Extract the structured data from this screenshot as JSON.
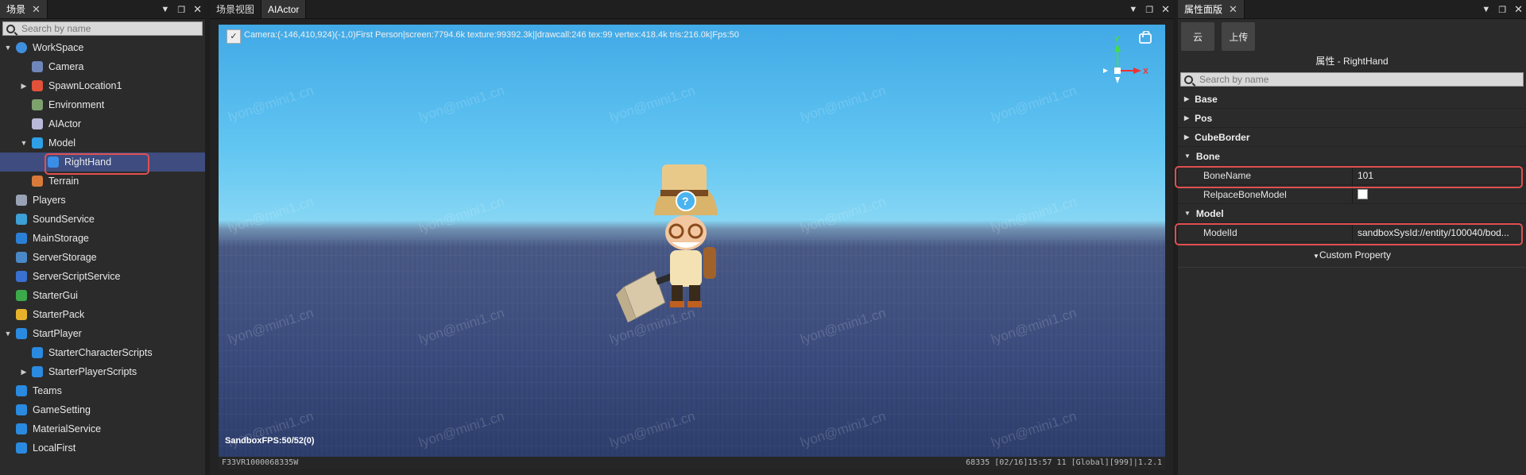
{
  "scene_panel": {
    "tab_label": "场景",
    "search_placeholder": "Search by name",
    "items": [
      {
        "label": "WorkSpace",
        "icon": "globe-icon",
        "color": "#3f8fe0",
        "expanded": "open"
      },
      {
        "label": "Camera",
        "icon": "camera-icon",
        "color": "#6f86b8"
      },
      {
        "label": "SpawnLocation1",
        "icon": "spawn-icon",
        "color": "#e2523a",
        "expanded": "closed"
      },
      {
        "label": "Environment",
        "icon": "environment-icon",
        "color": "#7ea26e"
      },
      {
        "label": "AIActor",
        "icon": "actor-icon",
        "color": "#b9b9d9"
      },
      {
        "label": "Model",
        "icon": "cube-icon",
        "color": "#2ea0e8",
        "expanded": "open"
      },
      {
        "label": "RightHand",
        "icon": "bone-icon",
        "color": "#3a8ee8"
      },
      {
        "label": "Terrain",
        "icon": "terrain-icon",
        "color": "#d97a3a"
      },
      {
        "label": "Players",
        "icon": "players-icon",
        "color": "#9aa2b6"
      },
      {
        "label": "SoundService",
        "icon": "sound-icon",
        "color": "#3da0d6"
      },
      {
        "label": "MainStorage",
        "icon": "storage-icon",
        "color": "#2c7fd6"
      },
      {
        "label": "ServerStorage",
        "icon": "storage-icon",
        "color": "#4a88c8"
      },
      {
        "label": "ServerScriptService",
        "icon": "script-service-icon",
        "color": "#3a70d0"
      },
      {
        "label": "StarterGui",
        "icon": "gui-icon",
        "color": "#3caa4a"
      },
      {
        "label": "StarterPack",
        "icon": "pack-icon",
        "color": "#e6b22c"
      },
      {
        "label": "StartPlayer",
        "icon": "player-icon",
        "color": "#2a8ae0",
        "expanded": "open"
      },
      {
        "label": "StarterCharacterScripts",
        "icon": "script-icon",
        "color": "#2a8ae0"
      },
      {
        "label": "StarterPlayerScripts",
        "icon": "script-icon",
        "color": "#2a8ae0",
        "expanded": "closed"
      },
      {
        "label": "Teams",
        "icon": "teams-icon",
        "color": "#2a8ae0"
      },
      {
        "label": "GameSetting",
        "icon": "settings-cube-icon",
        "color": "#2a8ae0"
      },
      {
        "label": "MaterialService",
        "icon": "material-icon",
        "color": "#2a8ae0"
      },
      {
        "label": "LocalFirst",
        "icon": "local-icon",
        "color": "#2a8ae0"
      }
    ]
  },
  "viewport": {
    "tab_scene": "场景视图",
    "tab_actor": "AIActor",
    "hud": "Camera:(-146,410,924)(-1,0)First Person|screen:7794.6k texture:99392.3k||drawcall:246 tex:99 vertex:418.4k tris:216.0k|Fps:50",
    "watermark": "lyon@mini1.cn",
    "fps": "SandboxFPS:50/52(0)",
    "status_left": "F33VR1000068335W",
    "status_right": "68335   [02/16]15:57 11  [Global][999]|1.2.1",
    "gizmo_x": "X",
    "gizmo_y": "Y"
  },
  "properties": {
    "tab_label": "属性面版",
    "btn_cloud": "云",
    "btn_upload": "上传",
    "title": "属性 - RightHand",
    "search_placeholder": "Search by name",
    "groups": {
      "base": "Base",
      "pos": "Pos",
      "cubeborder": "CubeBorder",
      "bone": "Bone",
      "model": "Model"
    },
    "bone_name_key": "BoneName",
    "bone_name_value": "101",
    "replace_key": "RelpaceBoneModel",
    "replace_checked": false,
    "model_id_key": "ModelId",
    "model_id_value": "sandboxSysId://entity/100040/bod...",
    "custom_property": "Custom Property"
  }
}
